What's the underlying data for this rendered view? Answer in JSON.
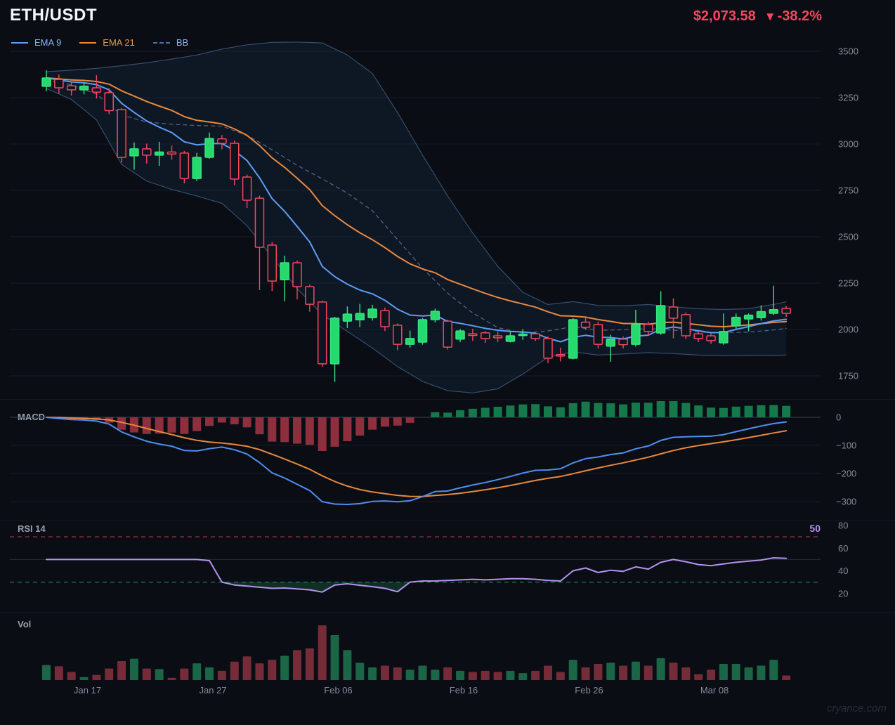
{
  "header": {
    "title": "ETH/USDT",
    "price": "$2,073.58",
    "down_arrow": "▼",
    "change": "-38.2%"
  },
  "legend": {
    "items": [
      {
        "label": "EMA 9",
        "color": "#5e9cf5",
        "text_color": "#8ab4f0",
        "style": "solid"
      },
      {
        "label": "EMA 21",
        "color": "#e8883f",
        "text_color": "#e09a55",
        "style": "solid"
      },
      {
        "label": "BB",
        "color": "#3d5a85",
        "text_color": "#8ab4f0",
        "style": "dashed"
      }
    ]
  },
  "panels": {
    "macd_label": "MACD",
    "rsi_label": "RSI 14",
    "rsi_current_value": "50",
    "vol_label": "Vol"
  },
  "watermark": "cryance.com",
  "colors": {
    "background": "#0a0d14",
    "price_red": "#f6465d",
    "candle_up": "#26d96c",
    "candle_up_stroke": "#3ae382",
    "candle_down": "#f4475f",
    "candle_down_fill": "#0e1420",
    "ema9": "#5e9cf5",
    "ema21": "#e8883f",
    "bb_line": "rgba(96,138,190,0.5)",
    "bb_fill": "rgba(49,97,160,0.12)",
    "bb_mid": "#56688a",
    "macd_line": "#4f8ef0",
    "macd_signal": "#e8883f",
    "macd_hist_pos": "#15794b",
    "macd_hist_neg": "#8e2f3e",
    "rsi_line": "#b493ec",
    "rsi_overbought": "rgba(214,72,87,0.75)",
    "rsi_oversold": "rgba(38,166,108,0.75)",
    "rsi_fill": "rgba(36,125,82,0.30)",
    "vol_up": "#1b6b4a",
    "vol_down": "#7c2e3a",
    "grid": "#141a26",
    "zero_line": "#3a4150",
    "axis_text": "#848b98"
  },
  "chart_data": {
    "type": "candlestick",
    "title": "ETH/USDT daily candles with EMA 9, EMA 21, Bollinger Bands, MACD, RSI 14 and Volume",
    "x_axis": {
      "tick_indices": [
        3,
        13,
        23,
        33,
        43,
        53
      ],
      "tick_labels": [
        "Jan 17",
        "Jan 27",
        "Feb 06",
        "Feb 16",
        "Feb 26",
        "Mar 08"
      ]
    },
    "price_axis": {
      "tick_values": [
        3500,
        3250,
        3000,
        2750,
        2500,
        2250,
        2000,
        1750
      ],
      "tick_labels": [
        "3500",
        "3250",
        "3000",
        "2750",
        "2500",
        "2250",
        "2000",
        "1750"
      ],
      "range": [
        1655,
        3560
      ]
    },
    "ohlc": [
      [
        3311,
        3398,
        3284,
        3356
      ],
      [
        3348,
        3375,
        3270,
        3303
      ],
      [
        3314,
        3340,
        3262,
        3292
      ],
      [
        3292,
        3330,
        3268,
        3312
      ],
      [
        3303,
        3371,
        3245,
        3280
      ],
      [
        3277,
        3300,
        3160,
        3180
      ],
      [
        3186,
        3195,
        2900,
        2928
      ],
      [
        2936,
        3008,
        2862,
        2974
      ],
      [
        2974,
        3002,
        2895,
        2940
      ],
      [
        2940,
        3012,
        2882,
        2957
      ],
      [
        2957,
        2992,
        2915,
        2946
      ],
      [
        2951,
        2962,
        2788,
        2814
      ],
      [
        2814,
        2952,
        2800,
        2928
      ],
      [
        2928,
        3062,
        2920,
        3030
      ],
      [
        3028,
        3048,
        2972,
        3004
      ],
      [
        3004,
        3018,
        2778,
        2811
      ],
      [
        2822,
        2835,
        2655,
        2697
      ],
      [
        2708,
        2722,
        2212,
        2443
      ],
      [
        2455,
        2472,
        2208,
        2261
      ],
      [
        2268,
        2398,
        2152,
        2360
      ],
      [
        2360,
        2372,
        2162,
        2231
      ],
      [
        2231,
        2242,
        2096,
        2136
      ],
      [
        2148,
        2155,
        1798,
        1815
      ],
      [
        1815,
        2068,
        1718,
        2061
      ],
      [
        2045,
        2124,
        2008,
        2083
      ],
      [
        2052,
        2138,
        2012,
        2086
      ],
      [
        2064,
        2132,
        2048,
        2110
      ],
      [
        2102,
        2118,
        1992,
        2015
      ],
      [
        2023,
        2032,
        1888,
        1920
      ],
      [
        1920,
        1994,
        1902,
        1951
      ],
      [
        1932,
        2062,
        1918,
        2053
      ],
      [
        2053,
        2112,
        2038,
        2098
      ],
      [
        2045,
        2052,
        1892,
        1905
      ],
      [
        1948,
        2002,
        1932,
        1992
      ],
      [
        1977,
        2004,
        1938,
        1968
      ],
      [
        1982,
        1992,
        1928,
        1951
      ],
      [
        1966,
        1988,
        1932,
        1955
      ],
      [
        1936,
        1992,
        1930,
        1966
      ],
      [
        1968,
        2002,
        1944,
        1974
      ],
      [
        1977,
        1987,
        1938,
        1951
      ],
      [
        1951,
        1962,
        1818,
        1845
      ],
      [
        1864,
        1902,
        1828,
        1858
      ],
      [
        1845,
        2062,
        1838,
        2053
      ],
      [
        2040,
        2066,
        1998,
        2012
      ],
      [
        2027,
        2042,
        1898,
        1920
      ],
      [
        1910,
        1972,
        1826,
        1948
      ],
      [
        1948,
        1962,
        1898,
        1918
      ],
      [
        1920,
        2106,
        1908,
        2027
      ],
      [
        2027,
        2042,
        1968,
        1989
      ],
      [
        1981,
        2206,
        1972,
        2129
      ],
      [
        2121,
        2168,
        1952,
        2061
      ],
      [
        2080,
        2092,
        1948,
        1966
      ],
      [
        1977,
        1992,
        1932,
        1951
      ],
      [
        1966,
        1978,
        1922,
        1940
      ],
      [
        1928,
        2086,
        1918,
        1989
      ],
      [
        2019,
        2086,
        2004,
        2066
      ],
      [
        2057,
        2086,
        1990,
        2077
      ],
      [
        2064,
        2130,
        2048,
        2096
      ],
      [
        2087,
        2236,
        2078,
        2107
      ],
      [
        2114,
        2126,
        2068,
        2087
      ]
    ],
    "ema_periods": {
      "fast": 9,
      "slow": 21
    },
    "bollinger_keyframes": [
      [
        0,
        3390,
        3300
      ],
      [
        2,
        3398,
        3240
      ],
      [
        4,
        3408,
        3130
      ],
      [
        6,
        3422,
        2890
      ],
      [
        8,
        3438,
        2800
      ],
      [
        10,
        3458,
        2755
      ],
      [
        12,
        3480,
        2720
      ],
      [
        14,
        3512,
        2680
      ],
      [
        16,
        3535,
        2560
      ],
      [
        18,
        3548,
        2390
      ],
      [
        20,
        3550,
        2220
      ],
      [
        22,
        3545,
        2080
      ],
      [
        24,
        3480,
        1990
      ],
      [
        26,
        3380,
        1900
      ],
      [
        28,
        3170,
        1800
      ],
      [
        30,
        2940,
        1720
      ],
      [
        32,
        2720,
        1670
      ],
      [
        34,
        2520,
        1658
      ],
      [
        36,
        2340,
        1680
      ],
      [
        38,
        2200,
        1760
      ],
      [
        40,
        2135,
        1850
      ],
      [
        42,
        2150,
        1880
      ],
      [
        44,
        2130,
        1862
      ],
      [
        46,
        2128,
        1868
      ],
      [
        48,
        2135,
        1875
      ],
      [
        50,
        2122,
        1870
      ],
      [
        52,
        2112,
        1862
      ],
      [
        54,
        2108,
        1858
      ],
      [
        56,
        2112,
        1860
      ],
      [
        58,
        2135,
        1860
      ],
      [
        59,
        2150,
        1862
      ]
    ],
    "macd": {
      "fast": 12,
      "slow": 26,
      "signal": 9,
      "axis_tick_labels": [
        "0",
        "−100",
        "−200",
        "−300"
      ],
      "axis_tick_values": [
        0,
        -100,
        -200,
        -300
      ]
    },
    "rsi": {
      "period": 14,
      "overbought": 70,
      "oversold": 30,
      "axis_tick_labels": [
        "80",
        "60",
        "40",
        "20"
      ],
      "axis_tick_values": [
        80,
        60,
        40,
        20
      ],
      "values": [
        50,
        50,
        50,
        50,
        50,
        50,
        50,
        50,
        50,
        50,
        50,
        50,
        50,
        49,
        30,
        27.5,
        26.5,
        25.5,
        24.5,
        24.8,
        24,
        23.2,
        21.2,
        27.5,
        28.5,
        27.2,
        26,
        24.5,
        21.5,
        30,
        31,
        31,
        31.5,
        32,
        32.5,
        32,
        32.5,
        33,
        33,
        32.5,
        31.5,
        31,
        40,
        42.5,
        38.5,
        40.5,
        39.5,
        43.5,
        41.5,
        47.5,
        50,
        48,
        45.5,
        44.5,
        46,
        47.5,
        48.5,
        49.5,
        51.5,
        51
      ]
    },
    "volume": [
      26,
      24,
      14,
      5,
      9,
      20,
      33,
      37,
      20,
      19,
      4,
      20,
      29,
      22,
      16,
      32,
      41,
      29,
      35,
      42,
      52,
      55,
      95,
      78,
      52,
      30,
      22,
      25,
      22,
      18,
      25,
      18,
      22,
      16,
      14,
      16,
      14,
      16,
      12,
      16,
      25,
      14,
      35,
      22,
      28,
      30,
      25,
      32,
      25,
      38,
      30,
      22,
      10,
      18,
      28,
      28,
      22,
      25,
      35,
      8
    ]
  }
}
